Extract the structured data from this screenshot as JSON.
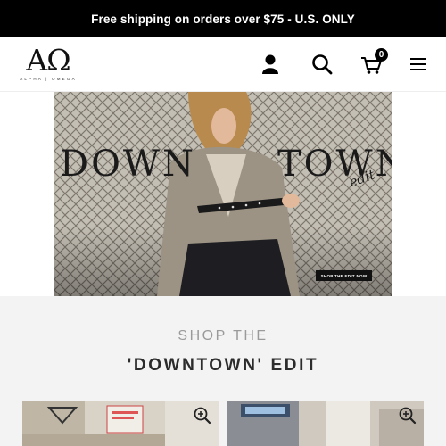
{
  "announcement": "Free shipping on orders over $75 - U.S. ONLY",
  "logo": {
    "mark": "AΩ",
    "subtitle": "ALPHA | OMEGA"
  },
  "header": {
    "cart_count": "0"
  },
  "hero": {
    "word_left": "DOWN",
    "word_right": "TOWN",
    "script": "edit",
    "cta": "SHOP THE EDIT NOW"
  },
  "section": {
    "small_title": "SHOP THE",
    "big_title": "'DOWNTOWN' EDIT"
  },
  "products": [
    {
      "name": "product-card-1"
    },
    {
      "name": "product-card-2"
    }
  ],
  "colors": {
    "bar": "#000000",
    "section_bg": "#f3f3f3",
    "muted": "#9a9a9a"
  }
}
